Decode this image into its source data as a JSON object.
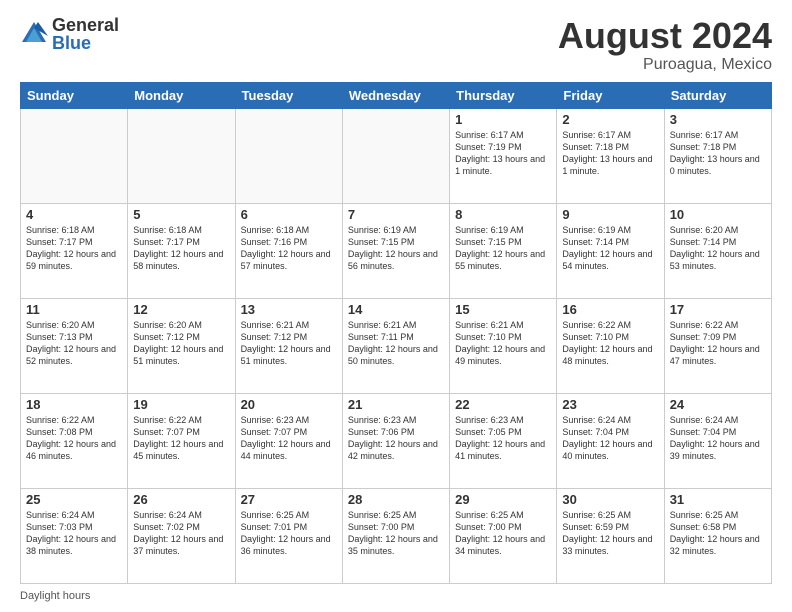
{
  "logo": {
    "general": "General",
    "blue": "Blue"
  },
  "title": "August 2024",
  "location": "Puroagua, Mexico",
  "days_of_week": [
    "Sunday",
    "Monday",
    "Tuesday",
    "Wednesday",
    "Thursday",
    "Friday",
    "Saturday"
  ],
  "footer": "Daylight hours",
  "weeks": [
    [
      {
        "day": "",
        "sunrise": "",
        "sunset": "",
        "daylight": "",
        "empty": true
      },
      {
        "day": "",
        "sunrise": "",
        "sunset": "",
        "daylight": "",
        "empty": true
      },
      {
        "day": "",
        "sunrise": "",
        "sunset": "",
        "daylight": "",
        "empty": true
      },
      {
        "day": "",
        "sunrise": "",
        "sunset": "",
        "daylight": "",
        "empty": true
      },
      {
        "day": "1",
        "sunrise": "Sunrise: 6:17 AM",
        "sunset": "Sunset: 7:19 PM",
        "daylight": "Daylight: 13 hours and 1 minute."
      },
      {
        "day": "2",
        "sunrise": "Sunrise: 6:17 AM",
        "sunset": "Sunset: 7:18 PM",
        "daylight": "Daylight: 13 hours and 1 minute."
      },
      {
        "day": "3",
        "sunrise": "Sunrise: 6:17 AM",
        "sunset": "Sunset: 7:18 PM",
        "daylight": "Daylight: 13 hours and 0 minutes."
      }
    ],
    [
      {
        "day": "4",
        "sunrise": "Sunrise: 6:18 AM",
        "sunset": "Sunset: 7:17 PM",
        "daylight": "Daylight: 12 hours and 59 minutes."
      },
      {
        "day": "5",
        "sunrise": "Sunrise: 6:18 AM",
        "sunset": "Sunset: 7:17 PM",
        "daylight": "Daylight: 12 hours and 58 minutes."
      },
      {
        "day": "6",
        "sunrise": "Sunrise: 6:18 AM",
        "sunset": "Sunset: 7:16 PM",
        "daylight": "Daylight: 12 hours and 57 minutes."
      },
      {
        "day": "7",
        "sunrise": "Sunrise: 6:19 AM",
        "sunset": "Sunset: 7:15 PM",
        "daylight": "Daylight: 12 hours and 56 minutes."
      },
      {
        "day": "8",
        "sunrise": "Sunrise: 6:19 AM",
        "sunset": "Sunset: 7:15 PM",
        "daylight": "Daylight: 12 hours and 55 minutes."
      },
      {
        "day": "9",
        "sunrise": "Sunrise: 6:19 AM",
        "sunset": "Sunset: 7:14 PM",
        "daylight": "Daylight: 12 hours and 54 minutes."
      },
      {
        "day": "10",
        "sunrise": "Sunrise: 6:20 AM",
        "sunset": "Sunset: 7:14 PM",
        "daylight": "Daylight: 12 hours and 53 minutes."
      }
    ],
    [
      {
        "day": "11",
        "sunrise": "Sunrise: 6:20 AM",
        "sunset": "Sunset: 7:13 PM",
        "daylight": "Daylight: 12 hours and 52 minutes."
      },
      {
        "day": "12",
        "sunrise": "Sunrise: 6:20 AM",
        "sunset": "Sunset: 7:12 PM",
        "daylight": "Daylight: 12 hours and 51 minutes."
      },
      {
        "day": "13",
        "sunrise": "Sunrise: 6:21 AM",
        "sunset": "Sunset: 7:12 PM",
        "daylight": "Daylight: 12 hours and 51 minutes."
      },
      {
        "day": "14",
        "sunrise": "Sunrise: 6:21 AM",
        "sunset": "Sunset: 7:11 PM",
        "daylight": "Daylight: 12 hours and 50 minutes."
      },
      {
        "day": "15",
        "sunrise": "Sunrise: 6:21 AM",
        "sunset": "Sunset: 7:10 PM",
        "daylight": "Daylight: 12 hours and 49 minutes."
      },
      {
        "day": "16",
        "sunrise": "Sunrise: 6:22 AM",
        "sunset": "Sunset: 7:10 PM",
        "daylight": "Daylight: 12 hours and 48 minutes."
      },
      {
        "day": "17",
        "sunrise": "Sunrise: 6:22 AM",
        "sunset": "Sunset: 7:09 PM",
        "daylight": "Daylight: 12 hours and 47 minutes."
      }
    ],
    [
      {
        "day": "18",
        "sunrise": "Sunrise: 6:22 AM",
        "sunset": "Sunset: 7:08 PM",
        "daylight": "Daylight: 12 hours and 46 minutes."
      },
      {
        "day": "19",
        "sunrise": "Sunrise: 6:22 AM",
        "sunset": "Sunset: 7:07 PM",
        "daylight": "Daylight: 12 hours and 45 minutes."
      },
      {
        "day": "20",
        "sunrise": "Sunrise: 6:23 AM",
        "sunset": "Sunset: 7:07 PM",
        "daylight": "Daylight: 12 hours and 44 minutes."
      },
      {
        "day": "21",
        "sunrise": "Sunrise: 6:23 AM",
        "sunset": "Sunset: 7:06 PM",
        "daylight": "Daylight: 12 hours and 42 minutes."
      },
      {
        "day": "22",
        "sunrise": "Sunrise: 6:23 AM",
        "sunset": "Sunset: 7:05 PM",
        "daylight": "Daylight: 12 hours and 41 minutes."
      },
      {
        "day": "23",
        "sunrise": "Sunrise: 6:24 AM",
        "sunset": "Sunset: 7:04 PM",
        "daylight": "Daylight: 12 hours and 40 minutes."
      },
      {
        "day": "24",
        "sunrise": "Sunrise: 6:24 AM",
        "sunset": "Sunset: 7:04 PM",
        "daylight": "Daylight: 12 hours and 39 minutes."
      }
    ],
    [
      {
        "day": "25",
        "sunrise": "Sunrise: 6:24 AM",
        "sunset": "Sunset: 7:03 PM",
        "daylight": "Daylight: 12 hours and 38 minutes."
      },
      {
        "day": "26",
        "sunrise": "Sunrise: 6:24 AM",
        "sunset": "Sunset: 7:02 PM",
        "daylight": "Daylight: 12 hours and 37 minutes."
      },
      {
        "day": "27",
        "sunrise": "Sunrise: 6:25 AM",
        "sunset": "Sunset: 7:01 PM",
        "daylight": "Daylight: 12 hours and 36 minutes."
      },
      {
        "day": "28",
        "sunrise": "Sunrise: 6:25 AM",
        "sunset": "Sunset: 7:00 PM",
        "daylight": "Daylight: 12 hours and 35 minutes."
      },
      {
        "day": "29",
        "sunrise": "Sunrise: 6:25 AM",
        "sunset": "Sunset: 7:00 PM",
        "daylight": "Daylight: 12 hours and 34 minutes."
      },
      {
        "day": "30",
        "sunrise": "Sunrise: 6:25 AM",
        "sunset": "Sunset: 6:59 PM",
        "daylight": "Daylight: 12 hours and 33 minutes."
      },
      {
        "day": "31",
        "sunrise": "Sunrise: 6:25 AM",
        "sunset": "Sunset: 6:58 PM",
        "daylight": "Daylight: 12 hours and 32 minutes."
      }
    ]
  ]
}
